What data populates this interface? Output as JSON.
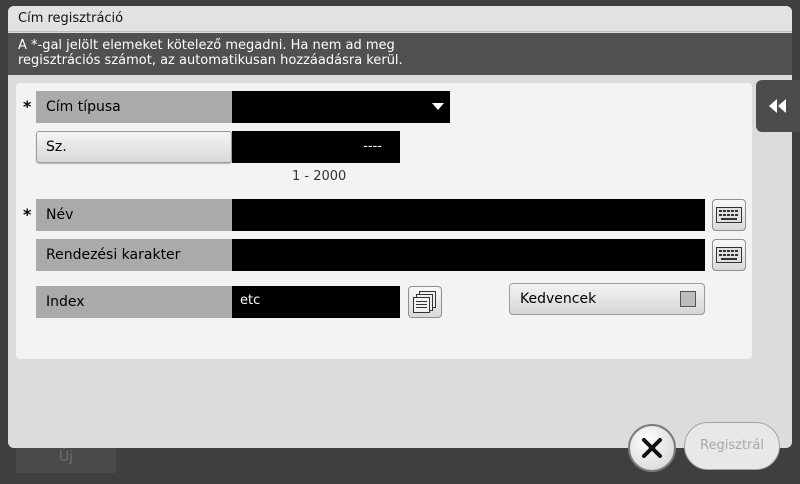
{
  "background": {
    "new_button_label": "Új"
  },
  "dialog": {
    "title": "Cím regisztráció",
    "message_line1": "A *-gal jelölt elemeket kötelező megadni. Ha nem ad meg",
    "message_line2": "regisztrációs számot, az automatikusan hozzáadásra kerül."
  },
  "form": {
    "required_marker": "*",
    "address_type": {
      "label": "Cím típusa",
      "value": ""
    },
    "number": {
      "button_label": "Sz.",
      "value": "----",
      "range_hint": "1 - 2000"
    },
    "name": {
      "label": "Név",
      "value": ""
    },
    "sort_character": {
      "label": "Rendezési karakter",
      "value": ""
    },
    "index": {
      "label": "Index",
      "value": "etc"
    },
    "favorites": {
      "label": "Kedvencek",
      "checked": false
    }
  },
  "footer": {
    "register_label": "Regisztrál"
  },
  "colors": {
    "accent_dark": "#505050",
    "field_black": "#000000",
    "label_gray": "#aaaaaa"
  }
}
